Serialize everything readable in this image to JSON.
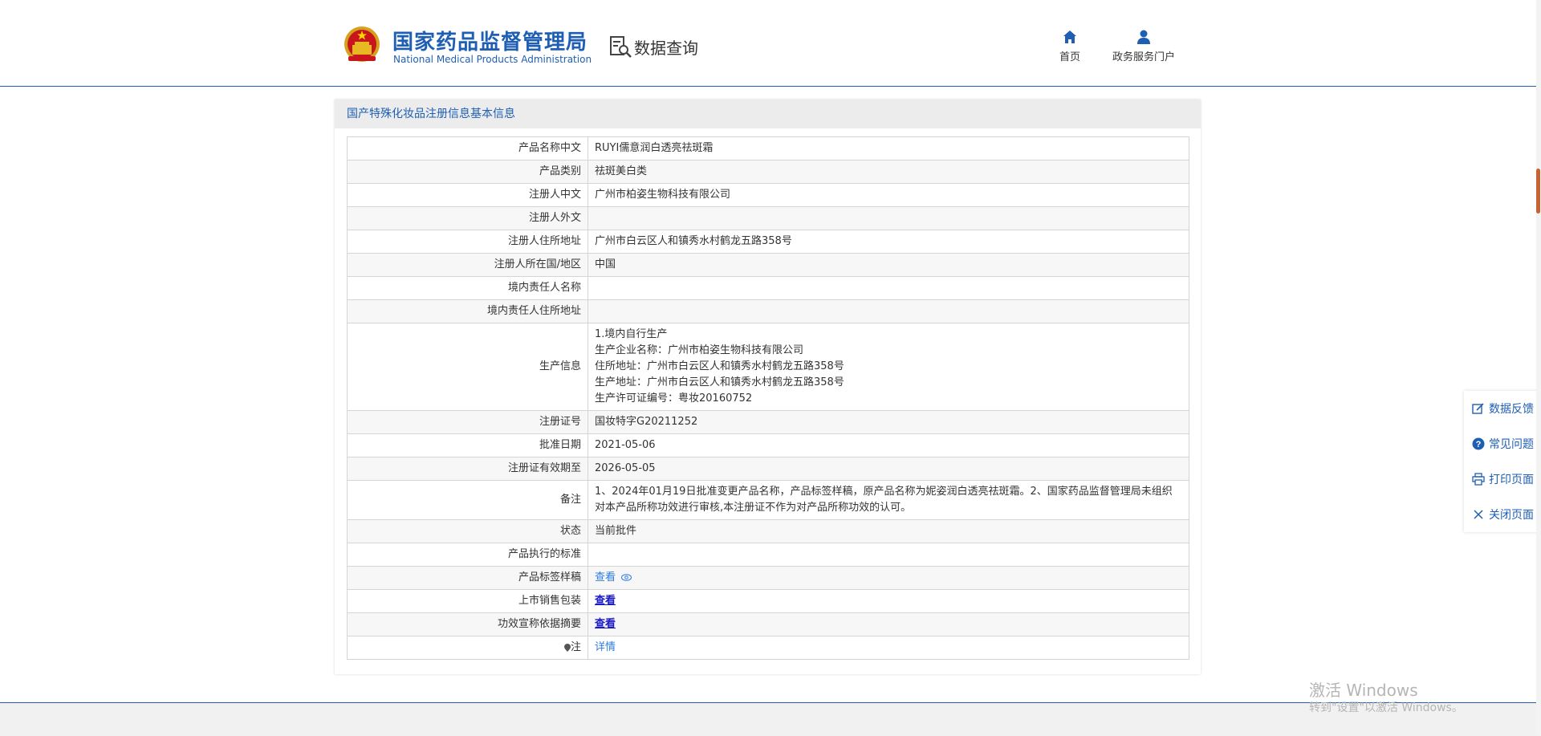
{
  "header": {
    "logo_cn": "国家药品监督管理局",
    "logo_en": "National Medical Products Administration",
    "data_query": "数据查询",
    "nav": [
      {
        "label": "首页",
        "icon": "home-icon"
      },
      {
        "label": "政务服务门户",
        "icon": "user-icon"
      }
    ]
  },
  "panel": {
    "title": "国产特殊化妆品注册信息基本信息",
    "rows": [
      {
        "label": "产品名称中文",
        "value": "RUYI儒意润白透亮祛斑霜"
      },
      {
        "label": "产品类别",
        "value": "祛斑美白类"
      },
      {
        "label": "注册人中文",
        "value": "广州市柏姿生物科技有限公司"
      },
      {
        "label": "注册人外文",
        "value": ""
      },
      {
        "label": "注册人住所地址",
        "value": "广州市白云区人和镇秀水村鹤龙五路358号"
      },
      {
        "label": "注册人所在国/地区",
        "value": "中国"
      },
      {
        "label": "境内责任人名称",
        "value": ""
      },
      {
        "label": "境内责任人住所地址",
        "value": ""
      },
      {
        "label": "生产信息",
        "lines": [
          "1.境内自行生产",
          "生产企业名称：广州市柏姿生物科技有限公司",
          "住所地址：广州市白云区人和镇秀水村鹤龙五路358号",
          "生产地址：广州市白云区人和镇秀水村鹤龙五路358号",
          "生产许可证编号：粤妆20160752"
        ]
      },
      {
        "label": "注册证号",
        "value": "国妆特字G20211252"
      },
      {
        "label": "批准日期",
        "value": "2021-05-06"
      },
      {
        "label": "注册证有效期至",
        "value": "2026-05-05"
      },
      {
        "label": "备注",
        "value": "1、2024年01月19日批准变更产品名称，产品标签样稿，原产品名称为妮姿润白透亮祛斑霜。2、国家药品监督管理局未组织对本产品所称功效进行审核,本注册证不作为对产品所称功效的认可。"
      },
      {
        "label": "状态",
        "value": "当前批件"
      },
      {
        "label": "产品执行的标准",
        "value": ""
      },
      {
        "label": "产品标签样稿",
        "link": "查看"
      },
      {
        "label": "上市销售包装",
        "link": "查看"
      },
      {
        "label": "功效宣称依据摘要",
        "link": "查看"
      },
      {
        "label": "注",
        "link": "详情"
      }
    ]
  },
  "side_tools": [
    {
      "label": "数据反馈",
      "icon": "edit-icon"
    },
    {
      "label": "常见问题",
      "icon": "question-icon"
    },
    {
      "label": "打印页面",
      "icon": "print-icon"
    },
    {
      "label": "关闭页面",
      "icon": "close-icon"
    }
  ],
  "watermark": {
    "line1": "激活 Windows",
    "line2": "转到\"设置\"以激活 Windows。"
  }
}
